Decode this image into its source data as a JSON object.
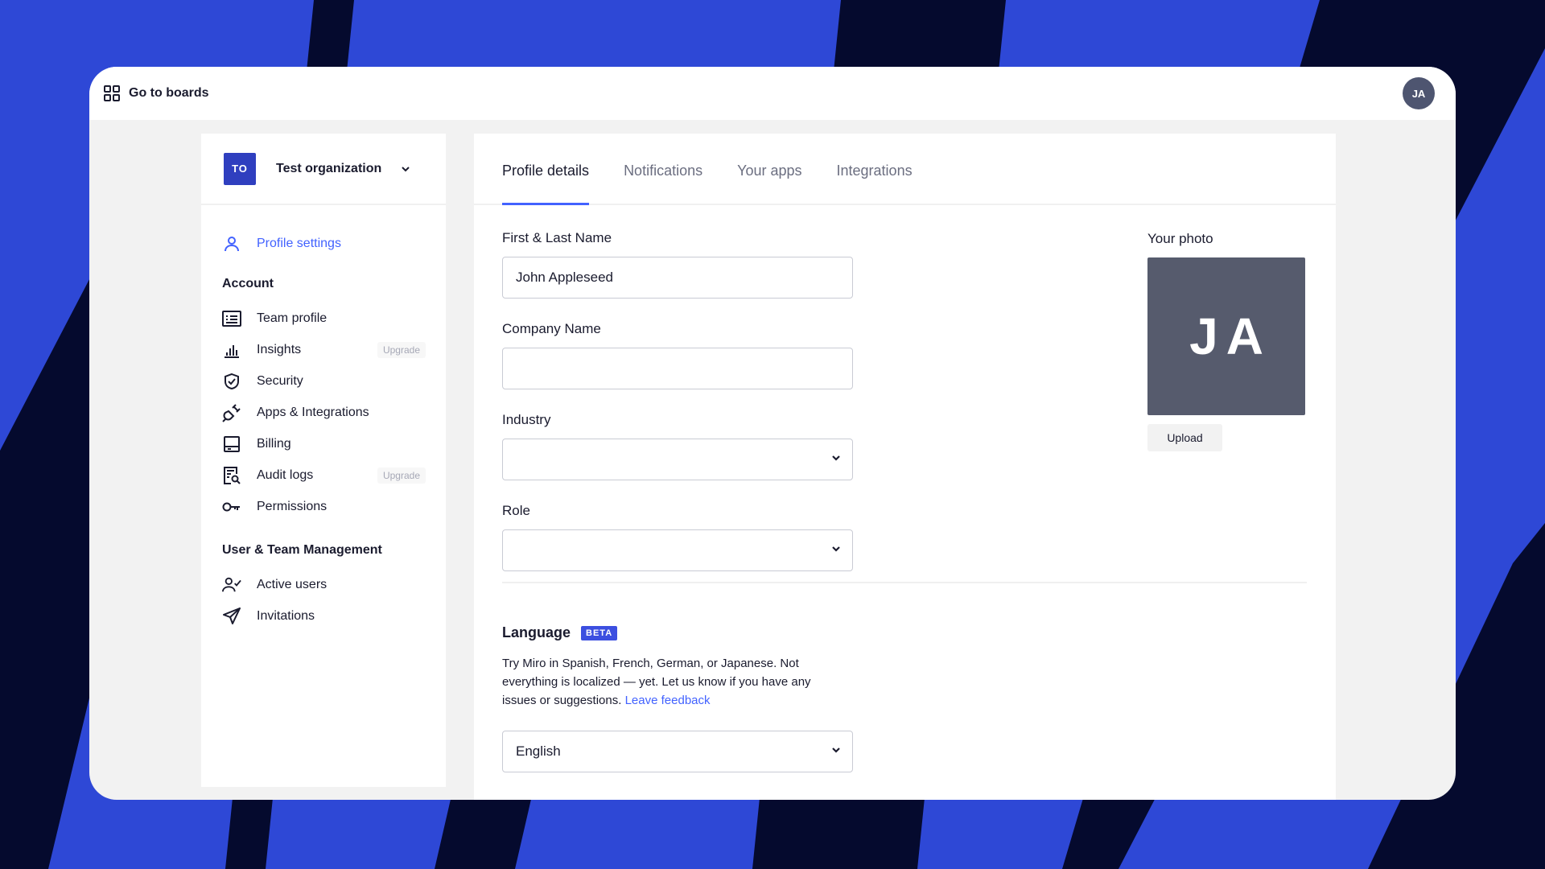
{
  "topbar": {
    "goto_label": "Go to boards",
    "avatar_initials": "JA"
  },
  "sidebar": {
    "org": {
      "badge": "TO",
      "name": "Test organization"
    },
    "profile_settings": "Profile settings",
    "account_heading": "Account",
    "account_items": [
      {
        "label": "Team profile",
        "icon": "team-profile-icon"
      },
      {
        "label": "Insights",
        "icon": "insights-icon",
        "badge": "Upgrade"
      },
      {
        "label": "Security",
        "icon": "shield-icon"
      },
      {
        "label": "Apps & Integrations",
        "icon": "plug-icon"
      },
      {
        "label": "Billing",
        "icon": "billing-icon"
      },
      {
        "label": "Audit logs",
        "icon": "audit-logs-icon",
        "badge": "Upgrade"
      },
      {
        "label": "Permissions",
        "icon": "key-icon"
      }
    ],
    "management_heading": "User & Team Management",
    "management_items": [
      {
        "label": "Active users",
        "icon": "active-users-icon"
      },
      {
        "label": "Invitations",
        "icon": "paper-plane-icon"
      }
    ]
  },
  "tabs": [
    {
      "label": "Profile details",
      "active": true
    },
    {
      "label": "Notifications"
    },
    {
      "label": "Your apps"
    },
    {
      "label": "Integrations"
    }
  ],
  "form": {
    "name_label": "First & Last Name",
    "name_value": "John Appleseed",
    "company_label": "Company Name",
    "company_value": "",
    "industry_label": "Industry",
    "industry_value": "",
    "role_label": "Role",
    "role_value": ""
  },
  "photo": {
    "label": "Your photo",
    "initials": "JA",
    "upload_label": "Upload"
  },
  "language": {
    "title": "Language",
    "beta": "BETA",
    "description": "Try Miro in Spanish, French, German, or Japanese. Not everything is localized — yet. Let us know if you have any issues or suggestions.",
    "feedback_link": "Leave feedback",
    "selected": "English"
  },
  "colors": {
    "accent": "#4262ff",
    "org_badge": "#2f3fbf",
    "avatar": "#565b6d",
    "bg_blue": "#2e48d6",
    "bg_navy": "#050a2e"
  }
}
